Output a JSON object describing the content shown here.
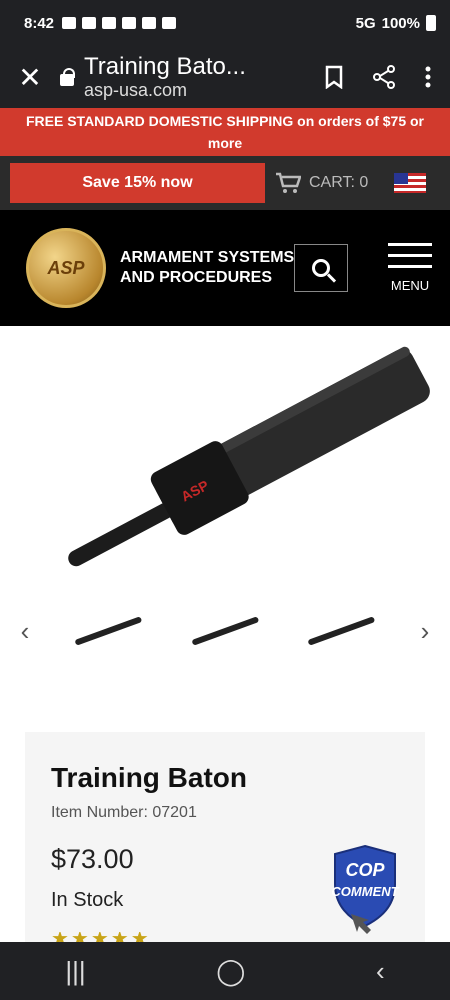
{
  "status": {
    "time": "8:42",
    "network": "5G",
    "battery": "100%"
  },
  "browser": {
    "title": "Training Bato...",
    "domain": "asp-usa.com",
    "close_label": "✕"
  },
  "promo": {
    "text": "FREE STANDARD DOMESTIC SHIPPING on orders of $75 or more"
  },
  "subbar": {
    "save_label": "Save 15% now",
    "cart_label": "CART: 0"
  },
  "header": {
    "logo_text": "ASP",
    "brand": "ARMAMENT SYSTEMS AND PROCEDURES",
    "menu_label": "MENU"
  },
  "product": {
    "title": "Training Baton",
    "item_number": "Item Number: 07201",
    "price": "$73.00",
    "stock": "In Stock",
    "rating_stars": 5,
    "badge_line1": "COP",
    "badge_line2": "COMMENT",
    "baton_mark": "ASP"
  },
  "nav": {
    "recent": "|||",
    "home": "◯",
    "back": "‹"
  }
}
